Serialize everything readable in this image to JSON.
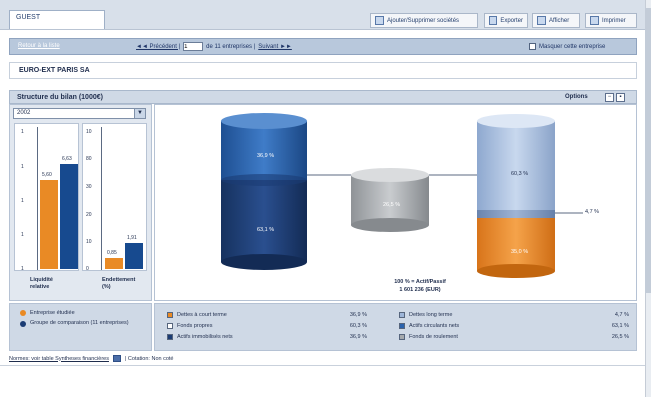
{
  "tab": {
    "label": "GUEST"
  },
  "toolbar": {
    "add_label": "Ajouter/Supprimer sociétés",
    "export_label": "Exporter",
    "print_label": "Afficher",
    "other_label": "Imprimer"
  },
  "nav": {
    "back_link": "Retour à la liste",
    "prev_label": "◄◄ Précédent |",
    "page_value": "1",
    "page_of": "de 11 entreprises |",
    "next_label": "Suivant ►►",
    "hide_label": "Masquer cette entreprise"
  },
  "company": {
    "name": "EURO-EXT PARIS SA"
  },
  "panel": {
    "title": "Structure du bilan (1000€)",
    "options_label": "Options",
    "year_select": "2002"
  },
  "left_chart": {
    "ticks": [
      "1",
      "1",
      "1",
      "1",
      "1"
    ],
    "ticks2": [
      "10",
      "80",
      "30",
      "20",
      "10",
      "0"
    ],
    "bars": [
      {
        "label": "5,60",
        "value": 5.6,
        "color": "#e98a25"
      },
      {
        "label": "6,63",
        "value": 6.63,
        "color": "#174a8f"
      }
    ],
    "bars2": [
      {
        "label": "0,85",
        "value": 0.85,
        "color": "#e98a25"
      },
      {
        "label": "1,91",
        "value": 1.91,
        "color": "#174a8f"
      }
    ],
    "cat1": [
      "Liquidité",
      "relative"
    ],
    "cat2": [
      "Endettement",
      "(%)"
    ]
  },
  "main_chart": {
    "left_top_pct": "36,9 %",
    "left_bottom_pct": "63,1 %",
    "middle_pct": "26,5 %",
    "right_top_pct": "60,3 %",
    "right_small_pct": "4,7 %",
    "right_bottom_pct": "35,0 %",
    "caption_line1": "100 % = Actif/Passif",
    "caption_line2": "1 601 236 (EUR)",
    "colors": {
      "dark_blue": "#1b3c74",
      "mid_blue": "#2b63ad",
      "gray": "#a5a9ad",
      "light_blue": "#9db5d8",
      "orange": "#e98a25"
    }
  },
  "legend_left": [
    {
      "label": "Entreprise étudiée",
      "color": "#e98a25"
    },
    {
      "label": "Groupe de comparaison (11 entreprises)",
      "color": "#1b3c74"
    }
  ],
  "legend_right_col1": [
    {
      "label": "Dettes à court terme",
      "value": "36,9 %",
      "color": "#e98a25"
    },
    {
      "label": "Fonds propres",
      "value": "60,3 %",
      "color": "#ffffff"
    },
    {
      "label": "Actifs immobilisés nets",
      "value": "36,9 %",
      "color": "#1b3c74"
    }
  ],
  "legend_right_col2": [
    {
      "label": "Dettes long terme",
      "value": "4,7 %",
      "color": "#9db5d8"
    },
    {
      "label": "Actifs circulants nets",
      "value": "63,1 %",
      "color": "#2b63ad"
    },
    {
      "label": "Fonds de roulement",
      "value": "26,5 %",
      "color": "#a5a9ad"
    }
  ],
  "footer": {
    "text1": "Normes: voir table Syntheses financières",
    "text2": "| Cotation: Non coté"
  }
}
